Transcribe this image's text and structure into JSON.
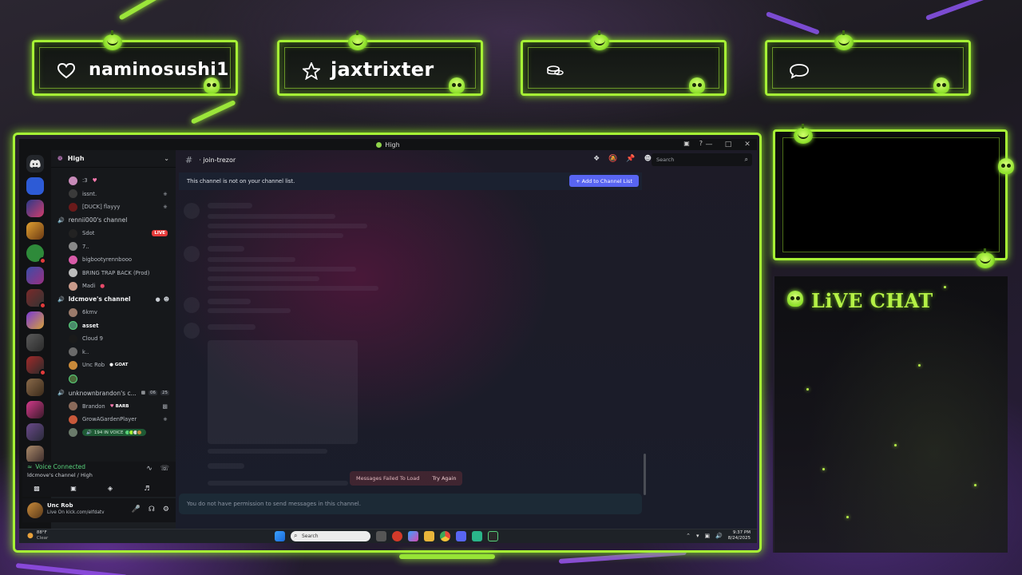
{
  "alerts": [
    {
      "icon": "heart-icon",
      "name": "naminosushi1"
    },
    {
      "icon": "star-icon",
      "name": "jaxtrixter"
    },
    {
      "icon": "coins-icon",
      "name": ""
    },
    {
      "icon": "chat-bubble-icon",
      "name": ""
    }
  ],
  "window": {
    "title": "High"
  },
  "server": {
    "name": "High"
  },
  "channel_list": {
    "top_users": [
      {
        "name": ":3"
      },
      {
        "name": "issnt."
      },
      {
        "name": "[DUCK] flayyy"
      }
    ],
    "voice_channels": [
      {
        "name": "rennii000's channel",
        "users": [
          {
            "name": "Sdot",
            "badge": "LIVE"
          },
          {
            "name": "7.."
          },
          {
            "name": "bigbootyrennbooo"
          },
          {
            "name": "BRING TRAP BACK (Prod)"
          },
          {
            "name": "Madi"
          }
        ]
      },
      {
        "name": "ldcmove's channel",
        "users": [
          {
            "name": "6kmv"
          },
          {
            "name": "asset"
          },
          {
            "name": "Cloud 9"
          },
          {
            "name": "k.."
          },
          {
            "name": "Unc Rob",
            "tag": "GOAT"
          },
          {
            "name": ""
          }
        ]
      },
      {
        "name": "unknownbrandon's c...",
        "count_video": "06",
        "count_users": "25",
        "users": [
          {
            "name": "Brandon",
            "tag": "BARB"
          },
          {
            "name": "GrowAGardenPlayer"
          },
          {
            "name": "",
            "pill": "194 IN VOICE"
          }
        ]
      }
    ]
  },
  "voice_panel": {
    "status": "Voice Connected",
    "channel": "ldcmove's channel / High"
  },
  "user_panel": {
    "name": "Unc Rob",
    "status": "Live On kick.com/elfdatv"
  },
  "main": {
    "channel_name": "join-trezor",
    "search_placeholder": "Search",
    "notice_text": "This channel is not on your channel list.",
    "add_button": "+ Add to Channel List",
    "fail_text": "Messages Failed To Load",
    "try_again": "Try Again",
    "composer_placeholder": "You do not have permission to send messages in this channel."
  },
  "taskbar": {
    "temp": "88°F",
    "weather": "Clear",
    "search_placeholder": "Search",
    "time": "9:37 PM",
    "date": "8/24/2025"
  },
  "chat": {
    "title": "LiVE CHAT"
  },
  "colors": {
    "accent_green": "#a6f135",
    "discord_blurple": "#5865f2",
    "live_red": "#e63a3a",
    "voice_green": "#58d17b"
  }
}
